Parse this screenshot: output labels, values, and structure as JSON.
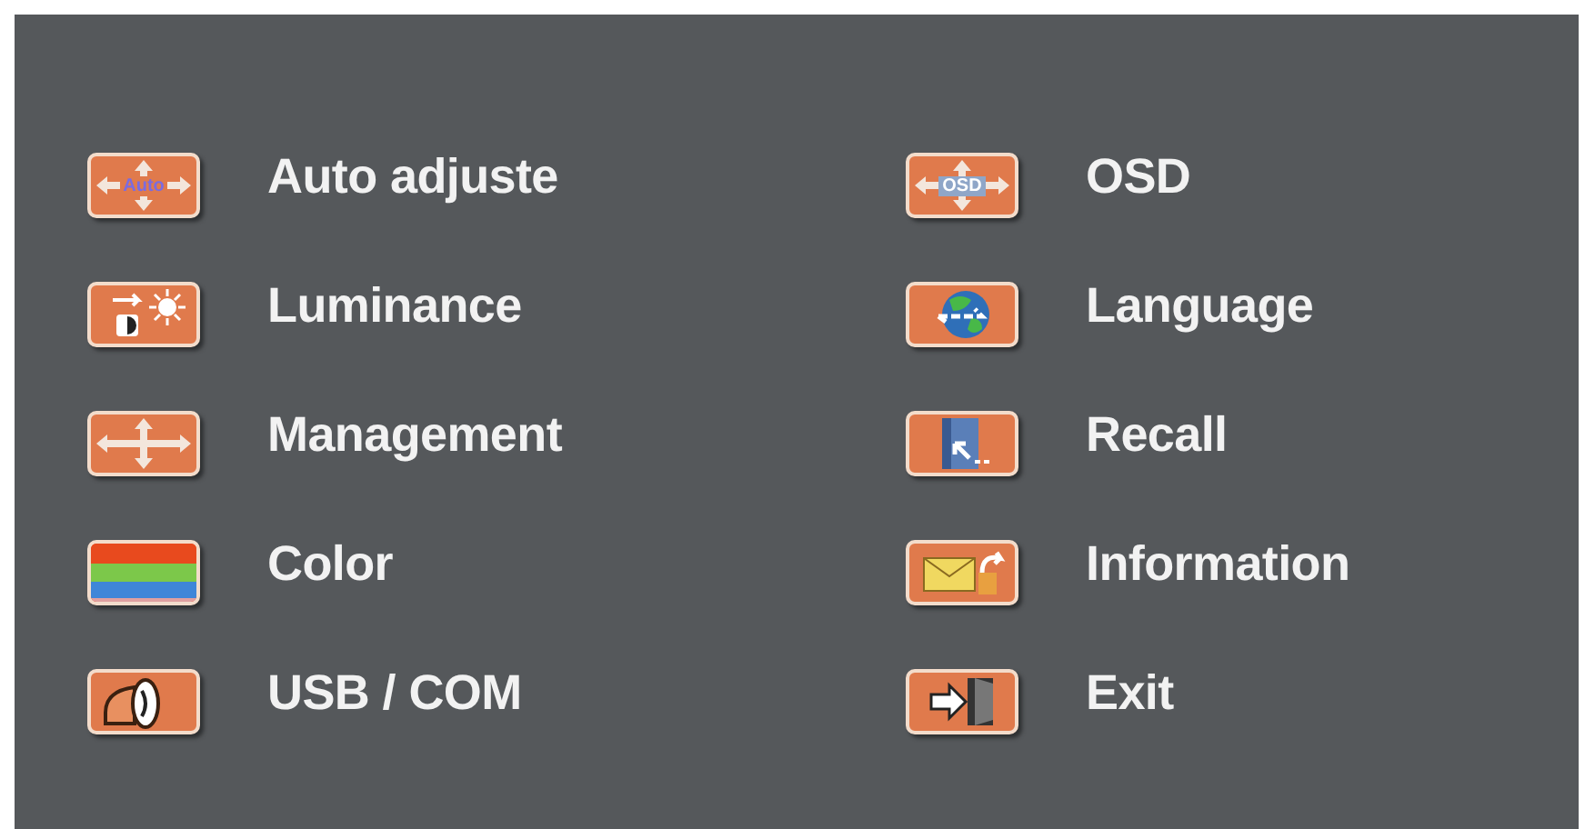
{
  "menu": {
    "items": [
      {
        "label": "Auto adjuste",
        "kind": "auto",
        "icon_text": "Auto"
      },
      {
        "label": "OSD",
        "kind": "osd",
        "icon_text": "OSD"
      },
      {
        "label": "Luminance",
        "kind": "luminance"
      },
      {
        "label": "Language",
        "kind": "language"
      },
      {
        "label": "Management",
        "kind": "position"
      },
      {
        "label": "Recall",
        "kind": "recall"
      },
      {
        "label": "Color",
        "kind": "color"
      },
      {
        "label": "Information",
        "kind": "information"
      },
      {
        "label": "USB / COM",
        "kind": "usb"
      },
      {
        "label": "Exit",
        "kind": "exit"
      }
    ]
  }
}
